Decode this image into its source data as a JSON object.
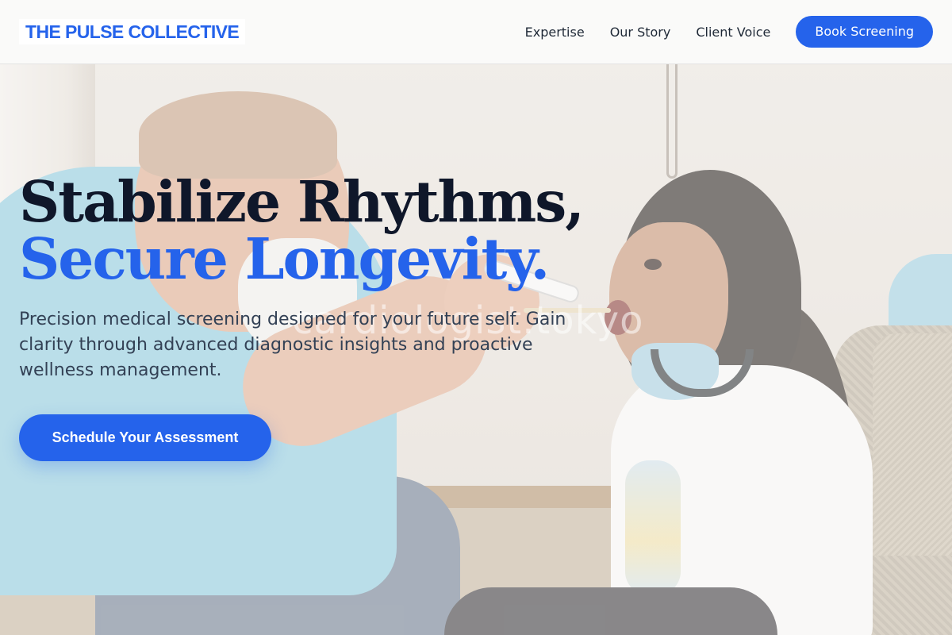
{
  "brand": {
    "name": "THE PULSE COLLECTIVE"
  },
  "nav": {
    "links": [
      "Expertise",
      "Our Story",
      "Client Voice"
    ],
    "cta": "Book Screening"
  },
  "hero": {
    "headline_line1": "Stabilize Rhythms,",
    "headline_line2": "Secure Longevity.",
    "subtitle": "Precision medical screening designed for your future self. Gain clarity through advanced diagnostic insights and proactive wellness management.",
    "cta": "Schedule Your Assessment",
    "watermark": "cardiologist.tokyo"
  },
  "colors": {
    "accent": "#2563eb",
    "heading": "#0f172a",
    "body_text": "#334155",
    "header_bg": "#fafaf9"
  }
}
